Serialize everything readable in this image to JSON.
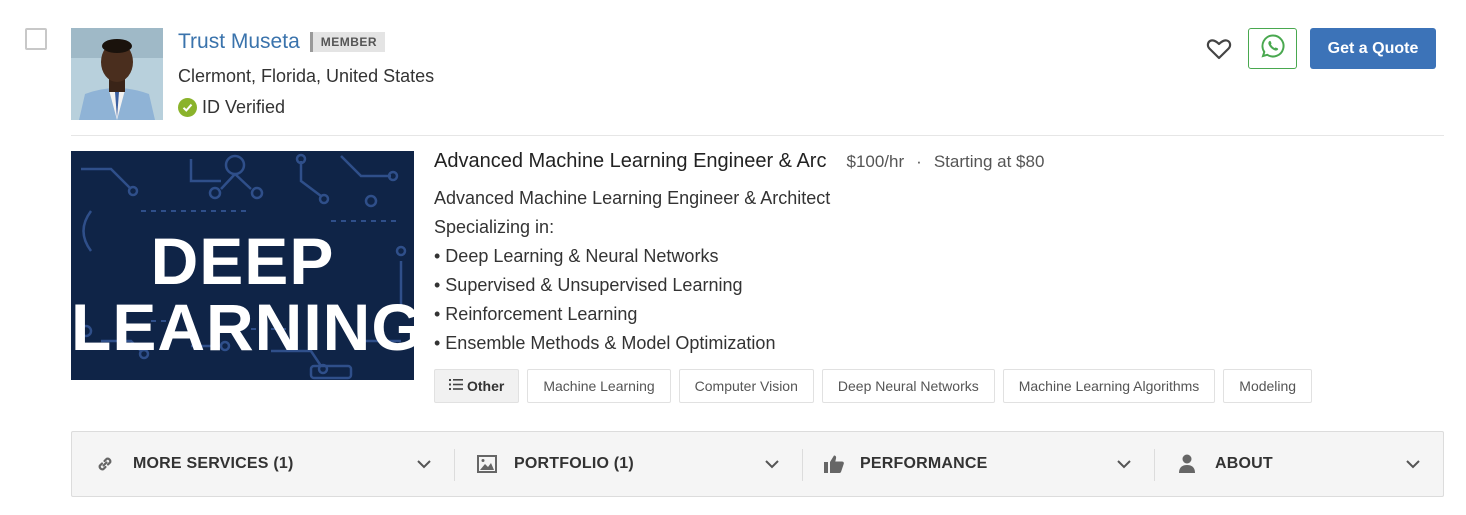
{
  "profile": {
    "name": "Trust Museta",
    "badge": "MEMBER",
    "location": "Clermont, Florida, United States",
    "verified_label": "ID Verified"
  },
  "actions": {
    "favorite_icon": "heart-icon",
    "whatsapp_icon": "whatsapp-icon",
    "quote_label": "Get a Quote"
  },
  "service": {
    "title": "Advanced Machine Learning Engineer & Arc",
    "rate": "$100/hr",
    "separator": "·",
    "starting": "Starting at $80",
    "image_line1": "DEEP",
    "image_line2": "LEARNING",
    "description": [
      "Advanced Machine Learning Engineer & Architect",
      "Specializing in:",
      "• Deep Learning & Neural Networks",
      "• Supervised & Unsupervised Learning",
      "• Reinforcement Learning",
      "• Ensemble Methods & Model Optimization"
    ],
    "tags": [
      "Other",
      "Machine Learning",
      "Computer Vision",
      "Deep Neural Networks",
      "Machine Learning Algorithms",
      "Modeling"
    ]
  },
  "sections": [
    {
      "label": "MORE SERVICES (1)",
      "icon": "link-icon"
    },
    {
      "label": "PORTFOLIO (1)",
      "icon": "image-icon"
    },
    {
      "label": "PERFORMANCE",
      "icon": "thumbs-up-icon"
    },
    {
      "label": "ABOUT",
      "icon": "user-icon"
    }
  ],
  "colors": {
    "link_blue": "#3a73ac",
    "quote_button": "#3c73b8",
    "whatsapp_green": "#49a84f",
    "verified_green": "#8ab32b",
    "image_bg": "#0f2447"
  }
}
